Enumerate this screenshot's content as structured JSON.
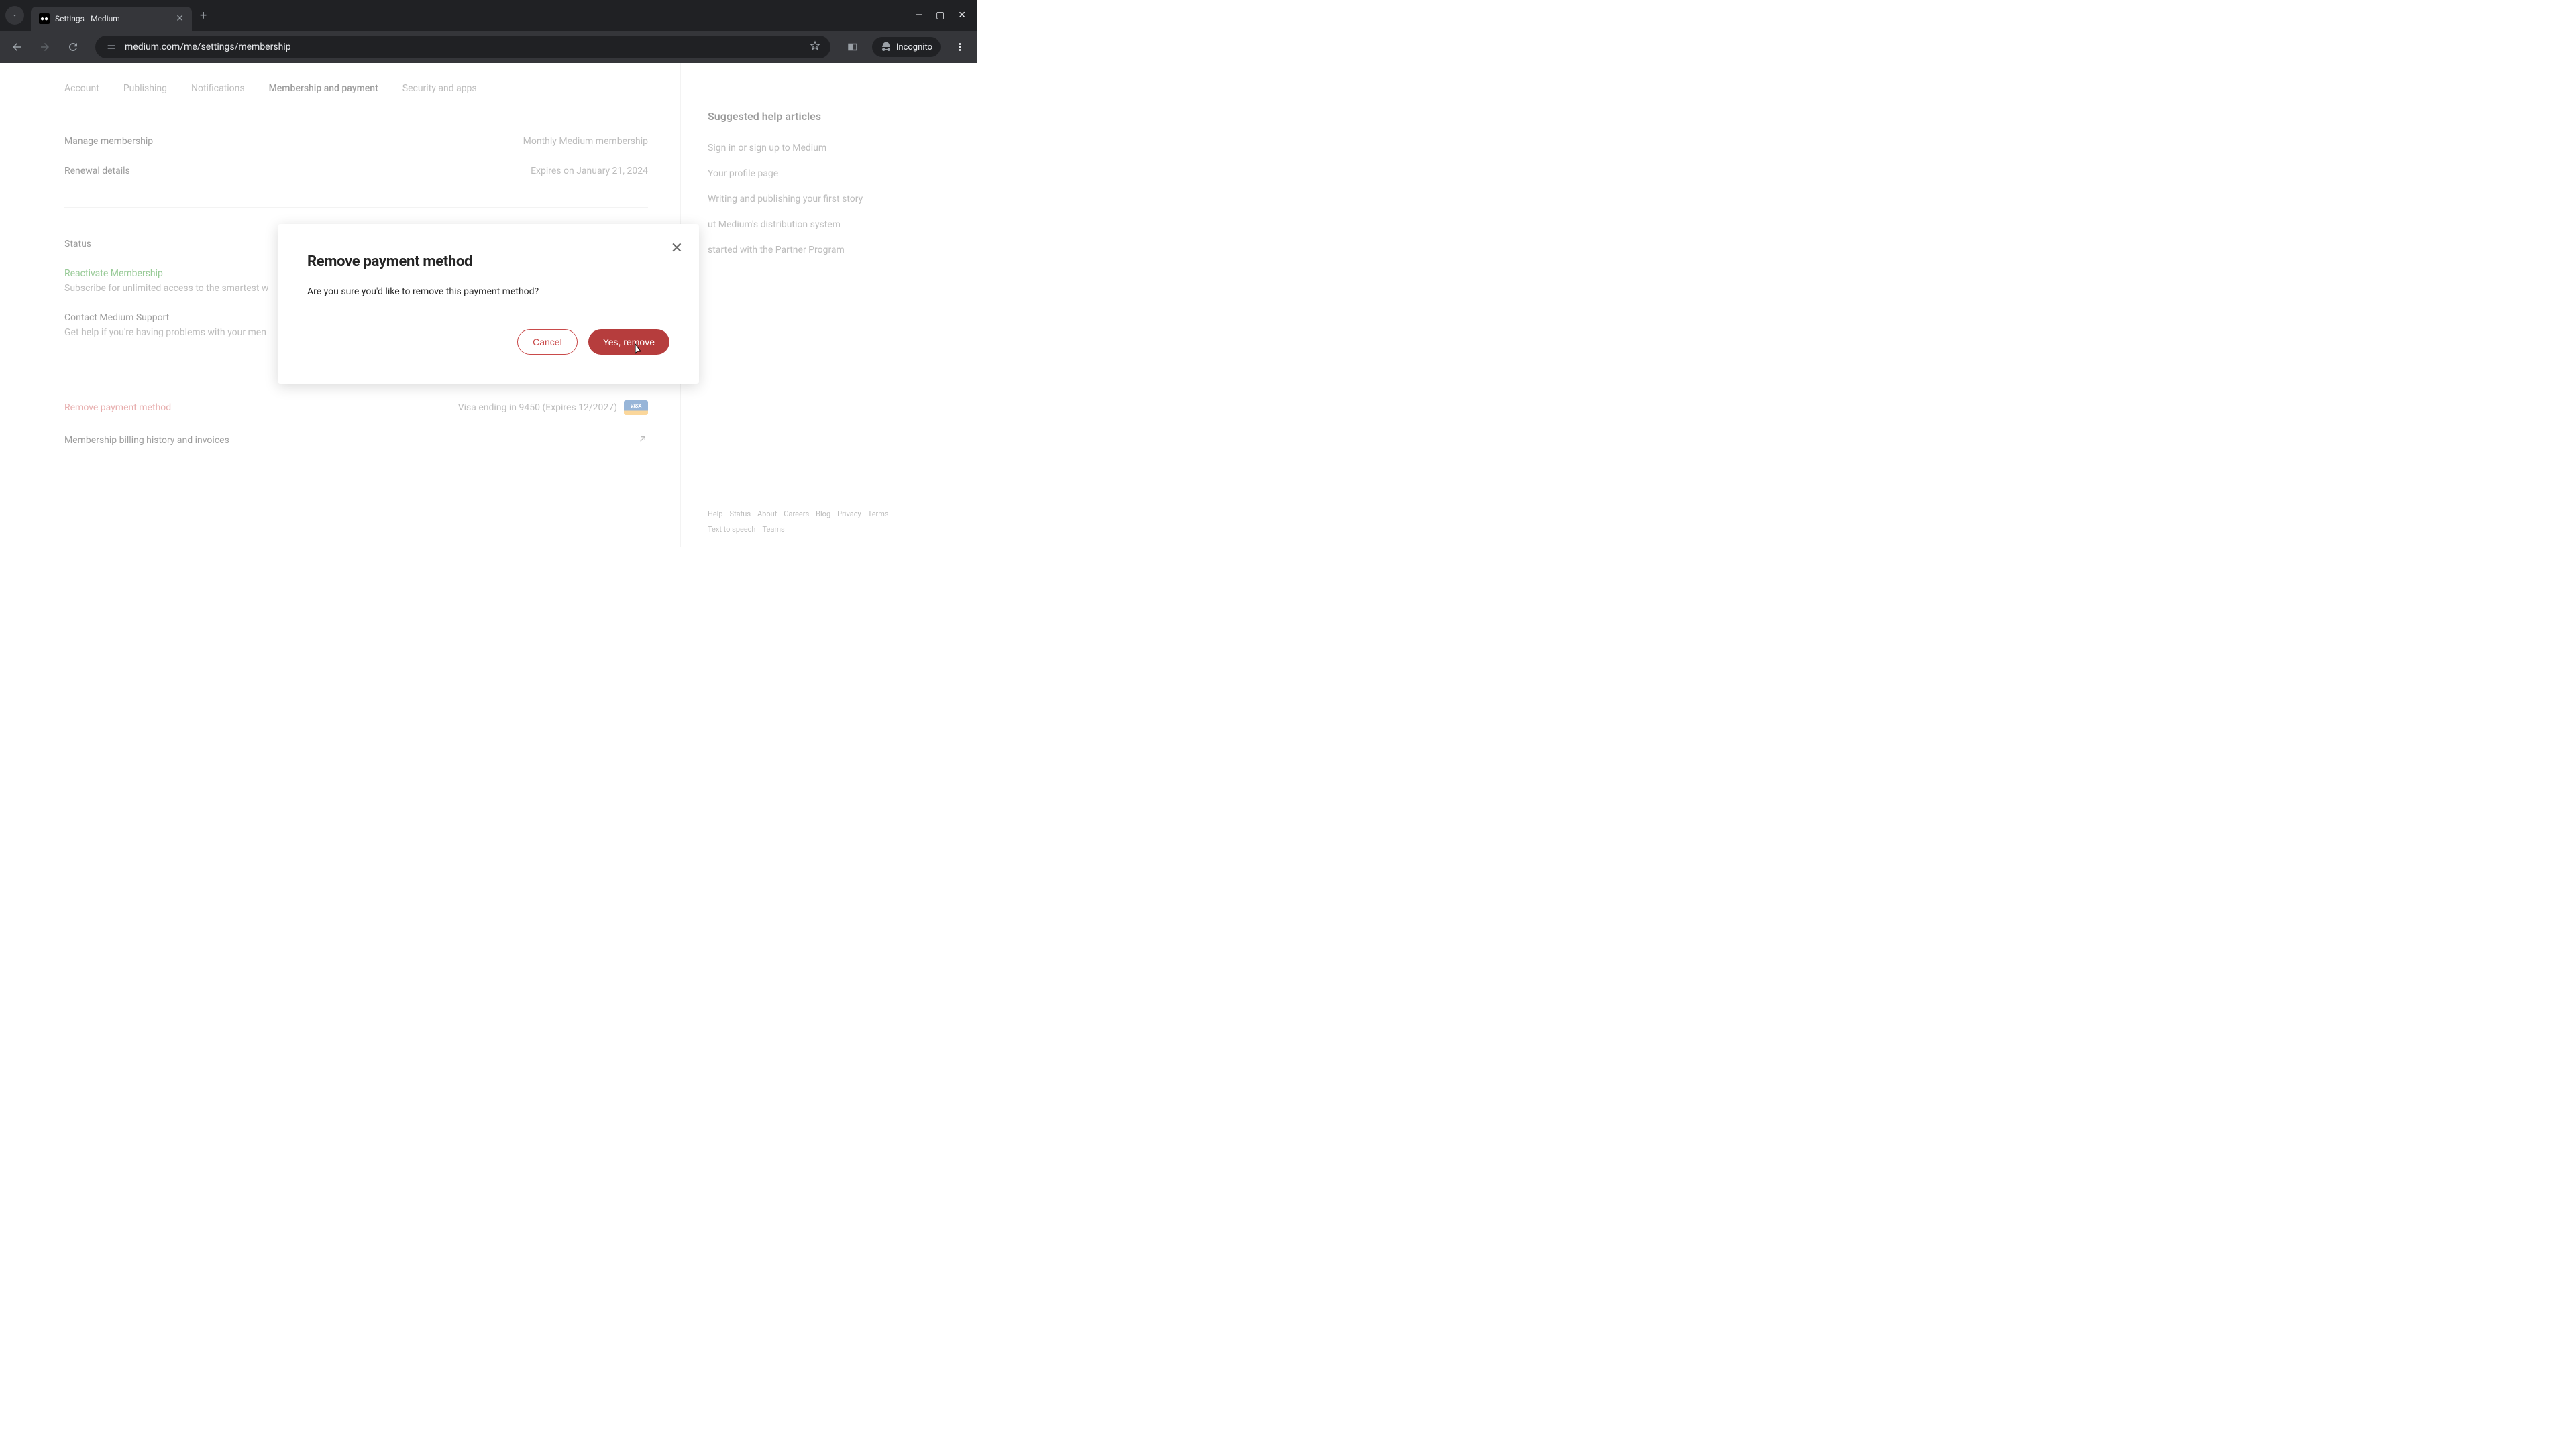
{
  "browser": {
    "tab_title": "Settings - Medium",
    "url": "medium.com/me/settings/membership",
    "incognito_label": "Incognito"
  },
  "tabs": {
    "account": "Account",
    "publishing": "Publishing",
    "notifications": "Notifications",
    "membership": "Membership and payment",
    "security": "Security and apps"
  },
  "membership": {
    "manage_label": "Manage membership",
    "manage_value": "Monthly Medium membership",
    "renewal_label": "Renewal details",
    "renewal_value": "Expires on January 21, 2024",
    "status_label": "Status",
    "reactivate": "Reactivate Membership",
    "reactivate_sub": "Subscribe for unlimited access to the smartest w",
    "contact_title": "Contact Medium Support",
    "contact_sub": "Get help if you're having problems with your men",
    "remove_payment": "Remove payment method",
    "card_info": "Visa ending in 9450 (Expires 12/2027)",
    "visa_label": "VISA",
    "billing_history": "Membership billing history and invoices"
  },
  "sidebar": {
    "title": "Suggested help articles",
    "links": {
      "0": "Sign in or sign up to Medium",
      "1": "Your profile page",
      "2": "Writing and publishing your first story",
      "3": "ut Medium's distribution system",
      "4": "started with the Partner Program"
    }
  },
  "footer": {
    "help": "Help",
    "status": "Status",
    "about": "About",
    "careers": "Careers",
    "blog": "Blog",
    "privacy": "Privacy",
    "terms": "Terms",
    "tts": "Text to speech",
    "teams": "Teams"
  },
  "modal": {
    "title": "Remove payment method",
    "text": "Are you sure you'd like to remove this payment method?",
    "cancel": "Cancel",
    "confirm": "Yes, remove"
  }
}
